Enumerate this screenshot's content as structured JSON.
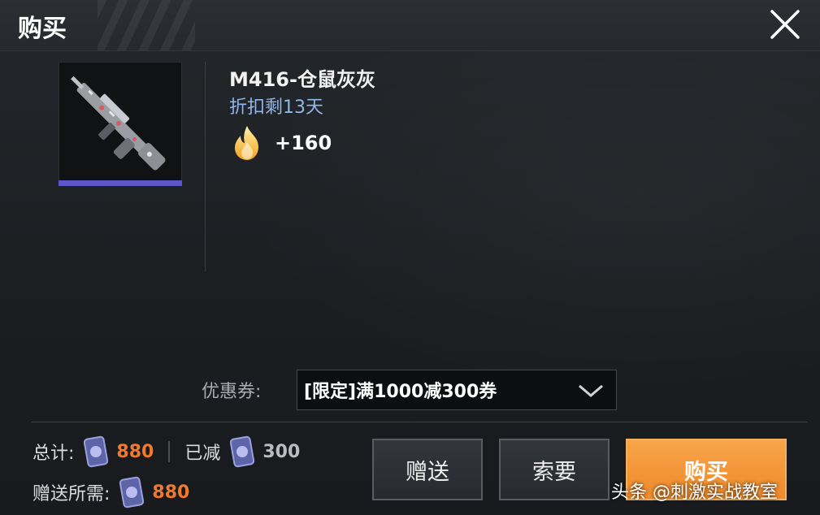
{
  "header": {
    "title": "购买"
  },
  "item": {
    "name": "M416-仓鼠灰灰",
    "discount_text": "折扣剩13天",
    "fire_value": "+160",
    "rarity_color": "#5e56c8"
  },
  "coupon": {
    "label": "优惠券:",
    "selected": "[限定]满1000减300券"
  },
  "summary": {
    "total_label": "总计:",
    "total_value": "880",
    "reduced_label": "已减",
    "reduced_value": "300",
    "gift_label": "赠送所需:",
    "gift_value": "880"
  },
  "buttons": {
    "gift": "赠送",
    "request": "索要",
    "buy": "购买"
  },
  "watermark": "头条 @刺激实战教室",
  "colors": {
    "accent_orange": "#ef7a2e",
    "discount_blue": "#8fb7ea",
    "buy_button": "#f39a3a"
  },
  "icons": [
    "close-icon",
    "fire-icon",
    "currency-coin-icon",
    "chevron-down-icon",
    "m416-rifle-image"
  ]
}
